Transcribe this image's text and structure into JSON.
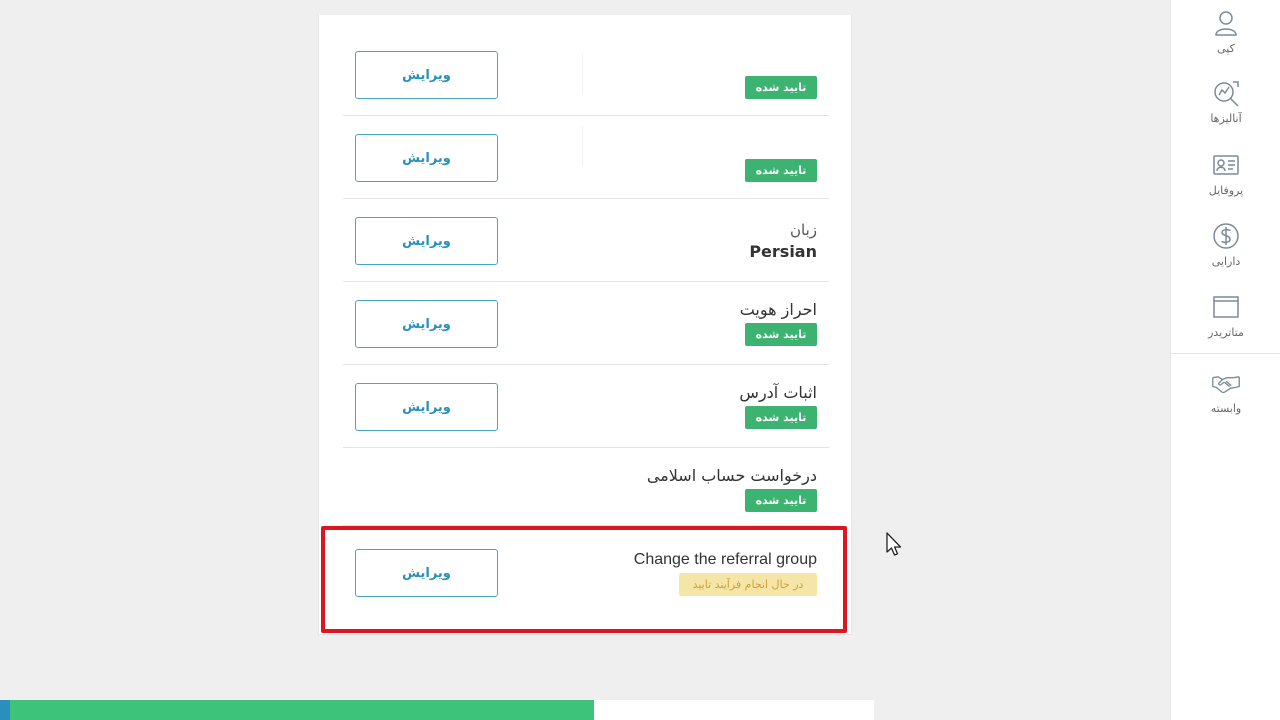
{
  "rows": [
    {
      "edit_label": "ویرایش",
      "status": "تایید شده"
    },
    {
      "edit_label": "ویرایش",
      "status": "تایید شده"
    },
    {
      "label": "زبان",
      "value": "Persian",
      "edit_label": "ویرایش"
    },
    {
      "label": "احراز هویت",
      "status": "تایید شده",
      "edit_label": "ویرایش"
    },
    {
      "label": "اثبات آدرس",
      "status": "تایید شده",
      "edit_label": "ویرایش"
    },
    {
      "label": "درخواست حساب اسلامی",
      "status": "تایید شده"
    },
    {
      "label": "Change the referral group",
      "status": "در حال انجام فرآیند تایید",
      "edit_label": "ویرایش"
    }
  ],
  "sidebar": {
    "items": [
      {
        "label": "کپی",
        "icon": "user-icon"
      },
      {
        "label": "آنالیزها",
        "icon": "analysis-icon"
      },
      {
        "label": "پروفایل",
        "icon": "profile-card-icon"
      },
      {
        "label": "دارایی",
        "icon": "dollar-icon"
      },
      {
        "label": "متاتریدر",
        "icon": "window-icon"
      },
      {
        "label": "وابسته",
        "icon": "handshake-icon"
      }
    ]
  },
  "bottom_bar": {
    "progress": 0.68
  },
  "colors": {
    "accent": "#2a8fbd",
    "verified": "#3cb371",
    "pending_bg": "#f5e6a8",
    "pending_text": "#caa03a",
    "highlight": "#e0141e"
  }
}
